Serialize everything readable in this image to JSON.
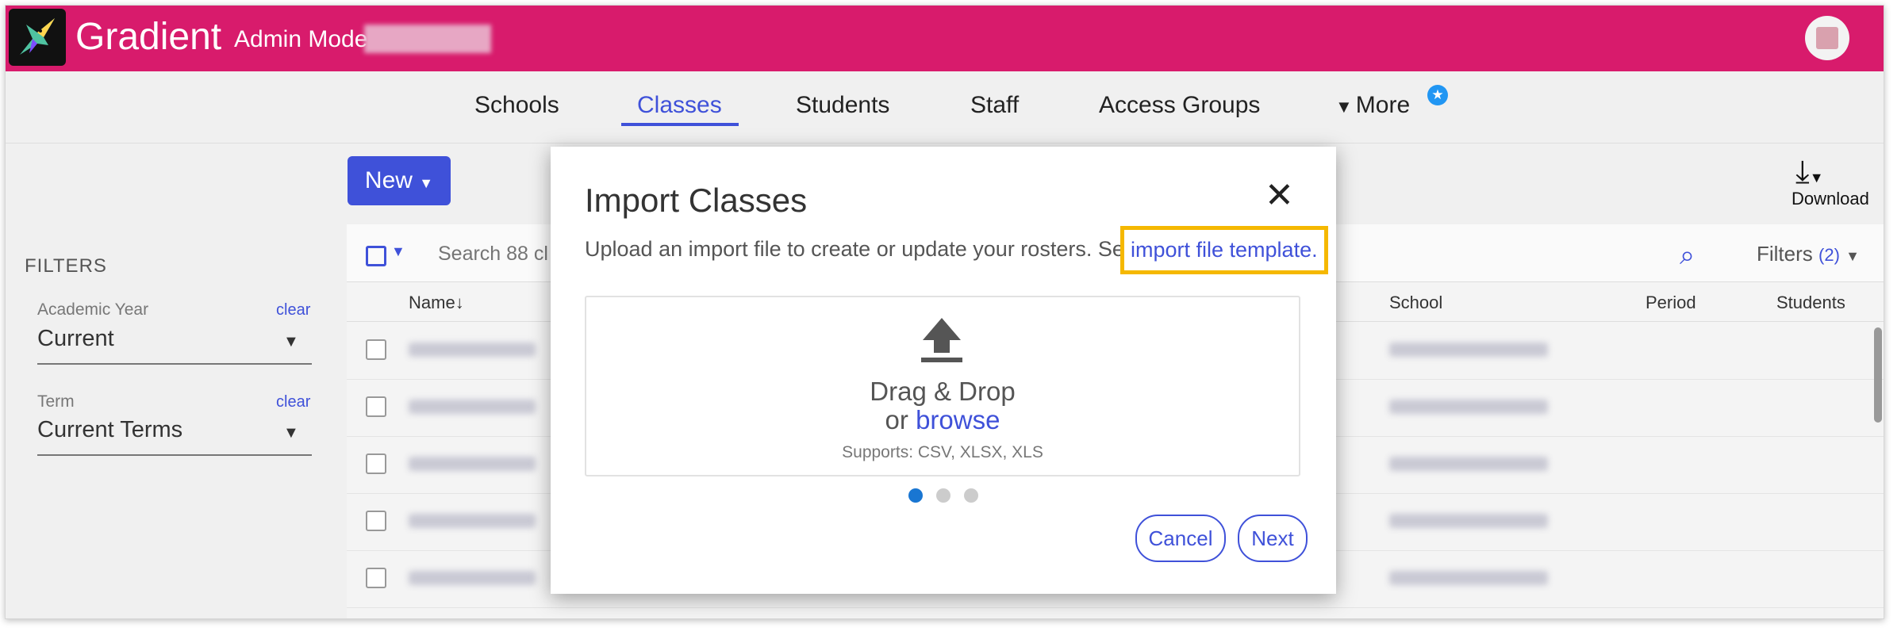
{
  "app": {
    "brand": "Gradient",
    "mode": "Admin Mode"
  },
  "nav": {
    "items": [
      "Schools",
      "Classes",
      "Students",
      "Staff",
      "Access Groups"
    ],
    "more": "More",
    "active": "Classes"
  },
  "toolbar": {
    "new_label": "New",
    "download_label": "Download"
  },
  "filters": {
    "title": "FILTERS",
    "academic_year": {
      "label": "Academic Year",
      "clear": "clear",
      "value": "Current"
    },
    "term": {
      "label": "Term",
      "clear": "clear",
      "value": "Current Terms"
    }
  },
  "table": {
    "search_placeholder": "Search 88 cl",
    "filters_label": "Filters",
    "filters_count": "(2)",
    "columns": {
      "name": "Name",
      "school": "School",
      "period": "Period",
      "students": "Students"
    },
    "sort_icon": "arrow-down-icon"
  },
  "modal": {
    "title": "Import Classes",
    "description": "Upload an import file to create or update your rosters. See the",
    "template_link": "import file template.",
    "drop_line1": "Drag & Drop",
    "drop_or": "or",
    "drop_browse": "browse",
    "supports": "Supports: CSV, XLSX, XLS",
    "cancel_label": "Cancel",
    "next_label": "Next"
  },
  "colors": {
    "brand": "#d81b6c",
    "accent": "#3f51d9",
    "highlight": "#f5b800",
    "step_active": "#1976d2"
  }
}
